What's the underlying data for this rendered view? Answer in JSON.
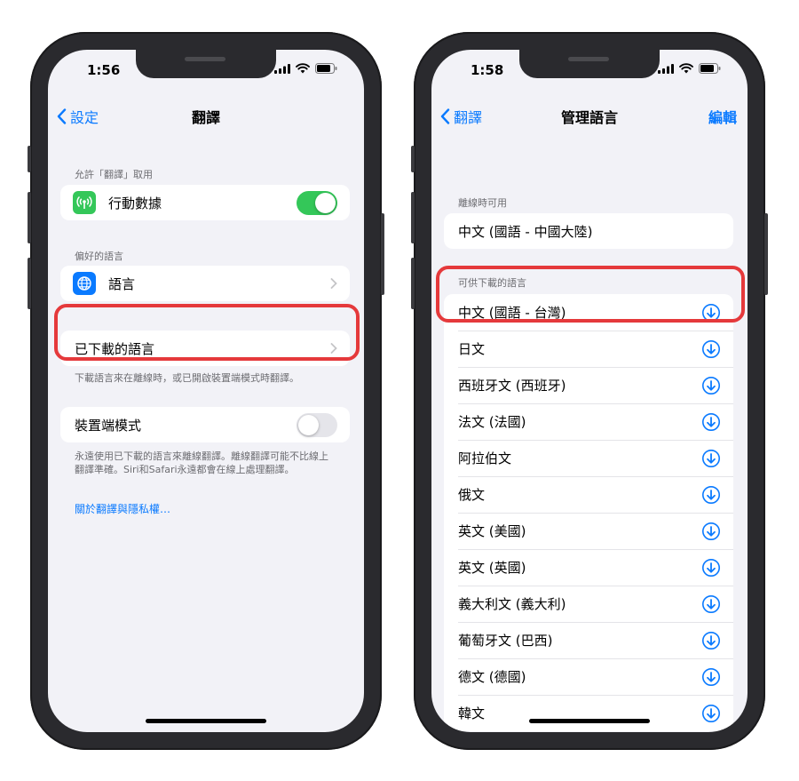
{
  "left_phone": {
    "status": {
      "time": "1:56"
    },
    "nav": {
      "back_label": "設定",
      "title": "翻譯"
    },
    "allow_header": "允許「翻譯」取用",
    "cellular_label": "行動數據",
    "cellular_on": true,
    "preferred_header": "偏好的語言",
    "language_label": "語言",
    "downloaded_label": "已下載的語言",
    "downloaded_footer": "下載語言來在離線時，或已開啟裝置端模式時翻譯。",
    "ondevice_label": "裝置端模式",
    "ondevice_on": false,
    "ondevice_footer": "永遠使用已下載的語言來離線翻譯。離線翻譯可能不比線上翻譯準確。Siri和Safari永遠都會在線上處理翻譯。",
    "privacy_link": "關於翻譯與隱私權…"
  },
  "right_phone": {
    "status": {
      "time": "1:58"
    },
    "nav": {
      "back_label": "翻譯",
      "title": "管理語言",
      "edit_label": "編輯"
    },
    "offline_header": "離線時可用",
    "offline_languages": [
      "中文 (國語 - 中國大陸)"
    ],
    "available_header": "可供下載的語言",
    "available_languages": [
      "中文 (國語 - 台灣)",
      "日文",
      "西班牙文 (西班牙)",
      "法文 (法國)",
      "阿拉伯文",
      "俄文",
      "英文 (美國)",
      "英文 (英國)",
      "義大利文 (義大利)",
      "葡萄牙文 (巴西)",
      "德文 (德國)",
      "韓文"
    ]
  },
  "colors": {
    "accent": "#0a7aff",
    "toggle_on": "#34c759",
    "highlight": "#e5393b",
    "background": "#f2f2f7"
  },
  "icons": {
    "cellular": "antenna-icon",
    "language": "globe-icon",
    "download": "download-circle-icon"
  }
}
